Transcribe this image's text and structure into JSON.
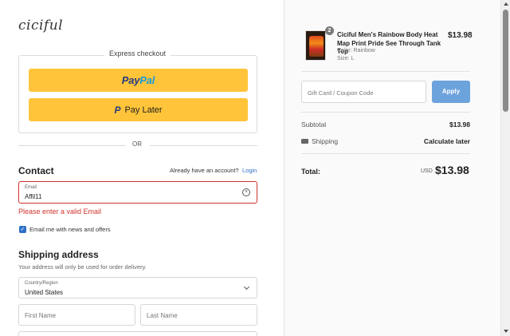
{
  "brand": {
    "logo_text": "ciciful"
  },
  "express": {
    "title": "Express checkout",
    "paypal_part1": "Pay",
    "paypal_part2": "Pal",
    "paylater_icon": "P",
    "paylater_label": "Pay Later",
    "button_color": "#ffc439"
  },
  "divider": {
    "or_text": "OR"
  },
  "contact": {
    "title": "Contact",
    "account_question": "Already have an account?",
    "login_label": "Login",
    "email_label": "Email",
    "email_value": "Affil11",
    "clear_icon": "×",
    "error_text": "Please enter a valid Email",
    "newsletter_checked": true,
    "newsletter_check_glyph": "✓",
    "newsletter_label": "Email me with news and offers"
  },
  "shipping": {
    "title": "Shipping address",
    "subtitle": "Your address will only be used for order delivery.",
    "country_label": "Country/Region",
    "country_value": "United States",
    "first_name_placeholder": "First Name",
    "last_name_placeholder": "Last Name"
  },
  "order": {
    "product": {
      "quantity": "2",
      "name": "Ciciful Men's Rainbow Body Heat Map Print Pride See Through Tank Top",
      "color": "Color: Rainbow",
      "size": "Size: L",
      "price": "$13.98"
    },
    "coupon_placeholder": "Gift Card / Coupon Code",
    "apply_label": "Apply",
    "subtotal_label": "Subtotal",
    "subtotal_value": "$13.98",
    "shipping_label": "Shipping",
    "shipping_value": "Calculate later",
    "total_label": "Total:",
    "total_currency": "USD",
    "total_value": "$13.98"
  },
  "colors": {
    "error": "#d0342c",
    "link": "#2f70c7",
    "apply_button": "#6ca3dc"
  }
}
